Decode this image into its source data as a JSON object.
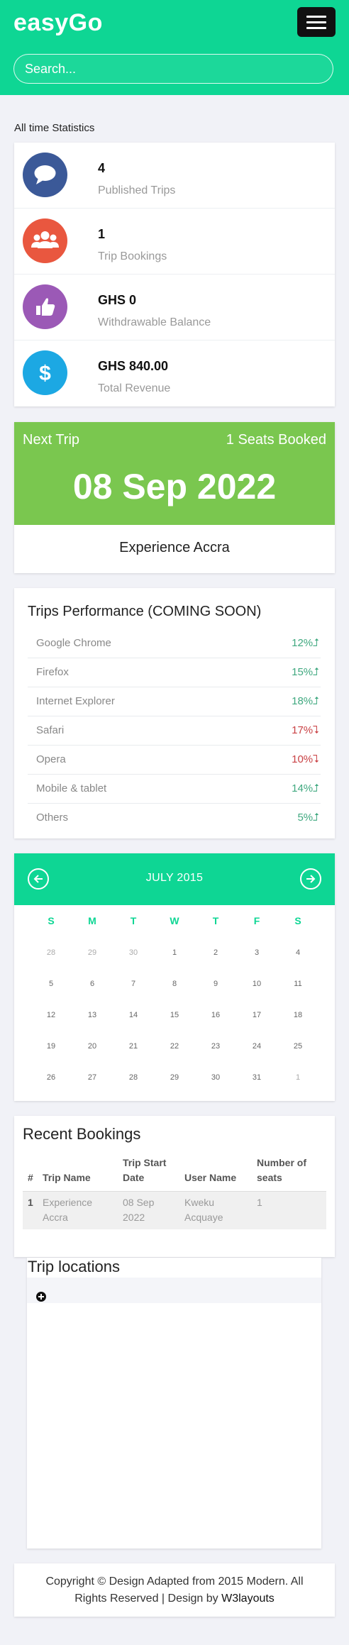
{
  "app": {
    "brand": "easyGo"
  },
  "search": {
    "placeholder": "Search..."
  },
  "stats": {
    "section_label": "All time Statistics",
    "items": [
      {
        "value": "4",
        "label": "Published Trips",
        "icon": "comment-icon",
        "color": "#3b5998"
      },
      {
        "value": "1",
        "label": "Trip Bookings",
        "icon": "users-icon",
        "color": "#e9573f"
      },
      {
        "value": "GHS 0",
        "label": "Withdrawable Balance",
        "icon": "thumbs-up-icon",
        "color": "#9b59b6"
      },
      {
        "value": "GHS 840.00",
        "label": "Total Revenue",
        "icon": "dollar-icon",
        "color": "#1ca8e3"
      }
    ]
  },
  "next_trip": {
    "title": "Next Trip",
    "seats": "1 Seats Booked",
    "date": "08 Sep 2022",
    "name": "Experience Accra",
    "color": "#7ac74f"
  },
  "performance": {
    "title": "Trips Performance (COMING SOON)",
    "rows": [
      {
        "name": "Google Chrome",
        "value": "12%",
        "trend": "up"
      },
      {
        "name": "Firefox",
        "value": "15%",
        "trend": "up"
      },
      {
        "name": "Internet Explorer",
        "value": "18%",
        "trend": "up"
      },
      {
        "name": "Safari",
        "value": "17%",
        "trend": "down"
      },
      {
        "name": "Opera",
        "value": "10%",
        "trend": "down"
      },
      {
        "name": "Mobile & tablet",
        "value": "14%",
        "trend": "up"
      },
      {
        "name": "Others",
        "value": "5%",
        "trend": "up"
      }
    ]
  },
  "calendar": {
    "month": "JULY 2015",
    "weekdays": [
      "S",
      "M",
      "T",
      "W",
      "T",
      "F",
      "S"
    ],
    "weeks": [
      [
        "28",
        "29",
        "30",
        "1",
        "2",
        "3",
        "4"
      ],
      [
        "5",
        "6",
        "7",
        "8",
        "9",
        "10",
        "11"
      ],
      [
        "12",
        "13",
        "14",
        "15",
        "16",
        "17",
        "18"
      ],
      [
        "19",
        "20",
        "21",
        "22",
        "23",
        "24",
        "25"
      ],
      [
        "26",
        "27",
        "28",
        "29",
        "30",
        "31",
        "1"
      ]
    ],
    "accent": "#0ed694"
  },
  "bookings": {
    "title": "Recent Bookings",
    "headers": [
      "#",
      "Trip Name",
      "Trip Start Date",
      "User Name",
      "Number of seats"
    ],
    "rows": [
      [
        "1",
        "Experience Accra",
        "08 Sep 2022",
        "Kweku Acquaye",
        "1"
      ]
    ]
  },
  "locations": {
    "title": "Trip locations"
  },
  "footer": {
    "text": "Copyright © Design Adapted from 2015 Modern. All Rights Reserved | Design by ",
    "link": "W3layouts"
  }
}
